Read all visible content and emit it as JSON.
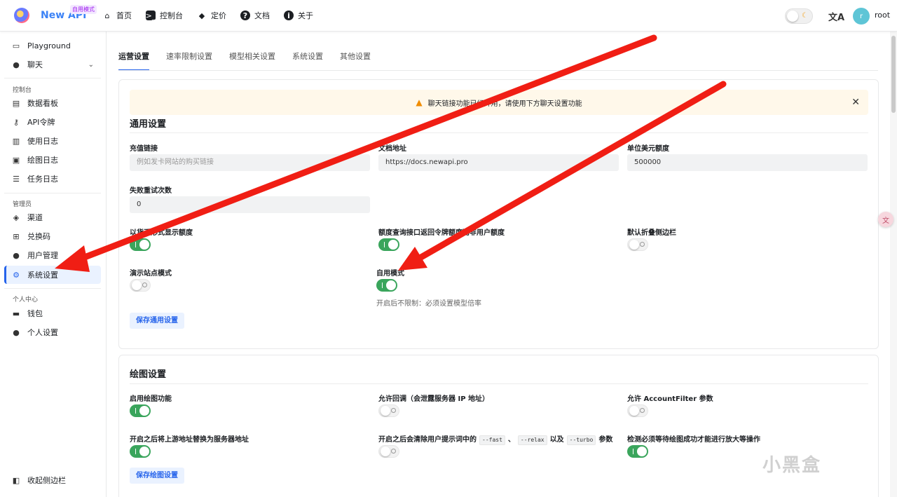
{
  "header": {
    "brand": "New API",
    "brand_badge": "自用模式",
    "nav": [
      {
        "label": "首页",
        "icon": "home-icon"
      },
      {
        "label": "控制台",
        "icon": "terminal-icon"
      },
      {
        "label": "定价",
        "icon": "tag-icon"
      },
      {
        "label": "文档",
        "icon": "help-icon"
      },
      {
        "label": "关于",
        "icon": "info-icon"
      }
    ],
    "avatar_letter": "r",
    "username": "root"
  },
  "sidebar": {
    "top_items": [
      {
        "label": "Playground",
        "icon": "playground-icon"
      },
      {
        "label": "聊天",
        "icon": "chat-icon"
      }
    ],
    "console_title": "控制台",
    "console_items": [
      {
        "label": "数据看板",
        "icon": "dashboard-icon"
      },
      {
        "label": "API令牌",
        "icon": "key-icon"
      },
      {
        "label": "使用日志",
        "icon": "bar-chart-icon"
      },
      {
        "label": "绘图日志",
        "icon": "image-icon"
      },
      {
        "label": "任务日志",
        "icon": "task-list-icon"
      }
    ],
    "admin_title": "管理员",
    "admin_items": [
      {
        "label": "渠道",
        "icon": "layers-icon"
      },
      {
        "label": "兑换码",
        "icon": "gift-icon"
      },
      {
        "label": "用户管理",
        "icon": "user-icon"
      },
      {
        "label": "系统设置",
        "icon": "gear-icon"
      }
    ],
    "personal_title": "个人中心",
    "personal_items": [
      {
        "label": "钱包",
        "icon": "wallet-icon"
      },
      {
        "label": "个人设置",
        "icon": "user-settings-icon"
      }
    ],
    "collapse_label": "收起侧边栏"
  },
  "tabs": [
    "运营设置",
    "速率限制设置",
    "模型相关设置",
    "系统设置",
    "其他设置"
  ],
  "general": {
    "banner": "聊天链接功能已经弃用，请使用下方聊天设置功能",
    "title": "通用设置",
    "recharge_label": "充值链接",
    "recharge_placeholder": "例如发卡网站的购买链接",
    "docs_label": "文档地址",
    "docs_value": "https://docs.newapi.pro",
    "quota_label": "单位美元额度",
    "quota_value": "500000",
    "retry_label": "失败重试次数",
    "retry_value": "0",
    "display_currency_label": "以货币形式显示额度",
    "token_quota_label": "额度查询接口返回令牌额度而非用户额度",
    "collapse_sidebar_label": "默认折叠侧边栏",
    "demo_label": "演示站点模式",
    "self_use_label": "自用模式",
    "self_use_help": "开启后不限制：必须设置模型倍率",
    "save_label": "保存通用设置"
  },
  "drawing": {
    "title": "绘图设置",
    "enable_label": "启用绘图功能",
    "callback_label": "允许回调（会泄露服务器 IP 地址）",
    "account_filter_label": "允许 AccountFilter 参数",
    "replace_upstream_label": "开启之后将上游地址替换为服务器地址",
    "clear_params_prefix": "开启之后会清除用户提示词中的",
    "param_fast": "--fast",
    "sep1": "、",
    "param_relax": "--relax",
    "sep2": "以及",
    "param_turbo": "--turbo",
    "clear_params_suffix": "参数",
    "wait_label": "检测必须等待绘图成功才能进行放大等操作",
    "save_label": "保存绘图设置"
  },
  "toggles": {
    "display_currency": true,
    "token_quota": true,
    "collapse_sidebar": false,
    "demo": false,
    "self_use": true,
    "enable_drawing": true,
    "callback": false,
    "account_filter": false,
    "replace_upstream": true,
    "clear_params": false,
    "wait_success": true
  },
  "watermark": "小黑盒",
  "colors": {
    "accent": "#2563eb",
    "switch_on": "#3aa55c",
    "annotation_arrow": "#f01e14"
  }
}
